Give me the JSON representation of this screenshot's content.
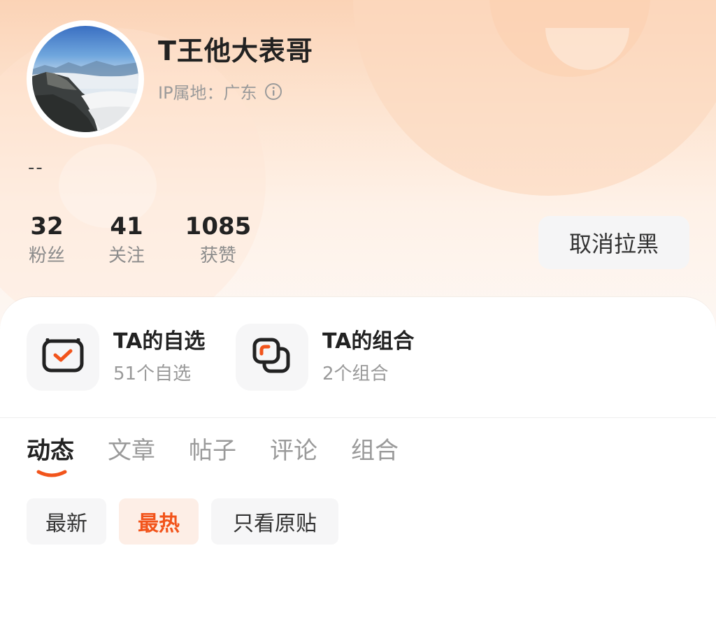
{
  "profile": {
    "name": "T王他大表哥",
    "ip_location": "IP属地：广东",
    "bio": "--"
  },
  "stats": [
    {
      "value": "32",
      "label": "粉丝"
    },
    {
      "value": "41",
      "label": "关注"
    },
    {
      "value": "1085",
      "label": "获赞"
    }
  ],
  "actions": {
    "unblock_label": "取消拉黑"
  },
  "features": [
    {
      "title": "TA的自选",
      "subtitle": "51个自选",
      "icon": "watchlist-check-icon"
    },
    {
      "title": "TA的组合",
      "subtitle": "2个组合",
      "icon": "portfolio-stack-icon"
    }
  ],
  "tabs": [
    {
      "label": "动态",
      "active": true
    },
    {
      "label": "文章",
      "active": false
    },
    {
      "label": "帖子",
      "active": false
    },
    {
      "label": "评论",
      "active": false
    },
    {
      "label": "组合",
      "active": false
    }
  ],
  "filters": [
    {
      "label": "最新",
      "active": false
    },
    {
      "label": "最热",
      "active": true
    },
    {
      "label": "只看原贴",
      "active": false
    }
  ],
  "colors": {
    "accent": "#f2541b",
    "header_gradient_top": "#fbd3b6",
    "chip_active_bg": "#fdeee6"
  }
}
